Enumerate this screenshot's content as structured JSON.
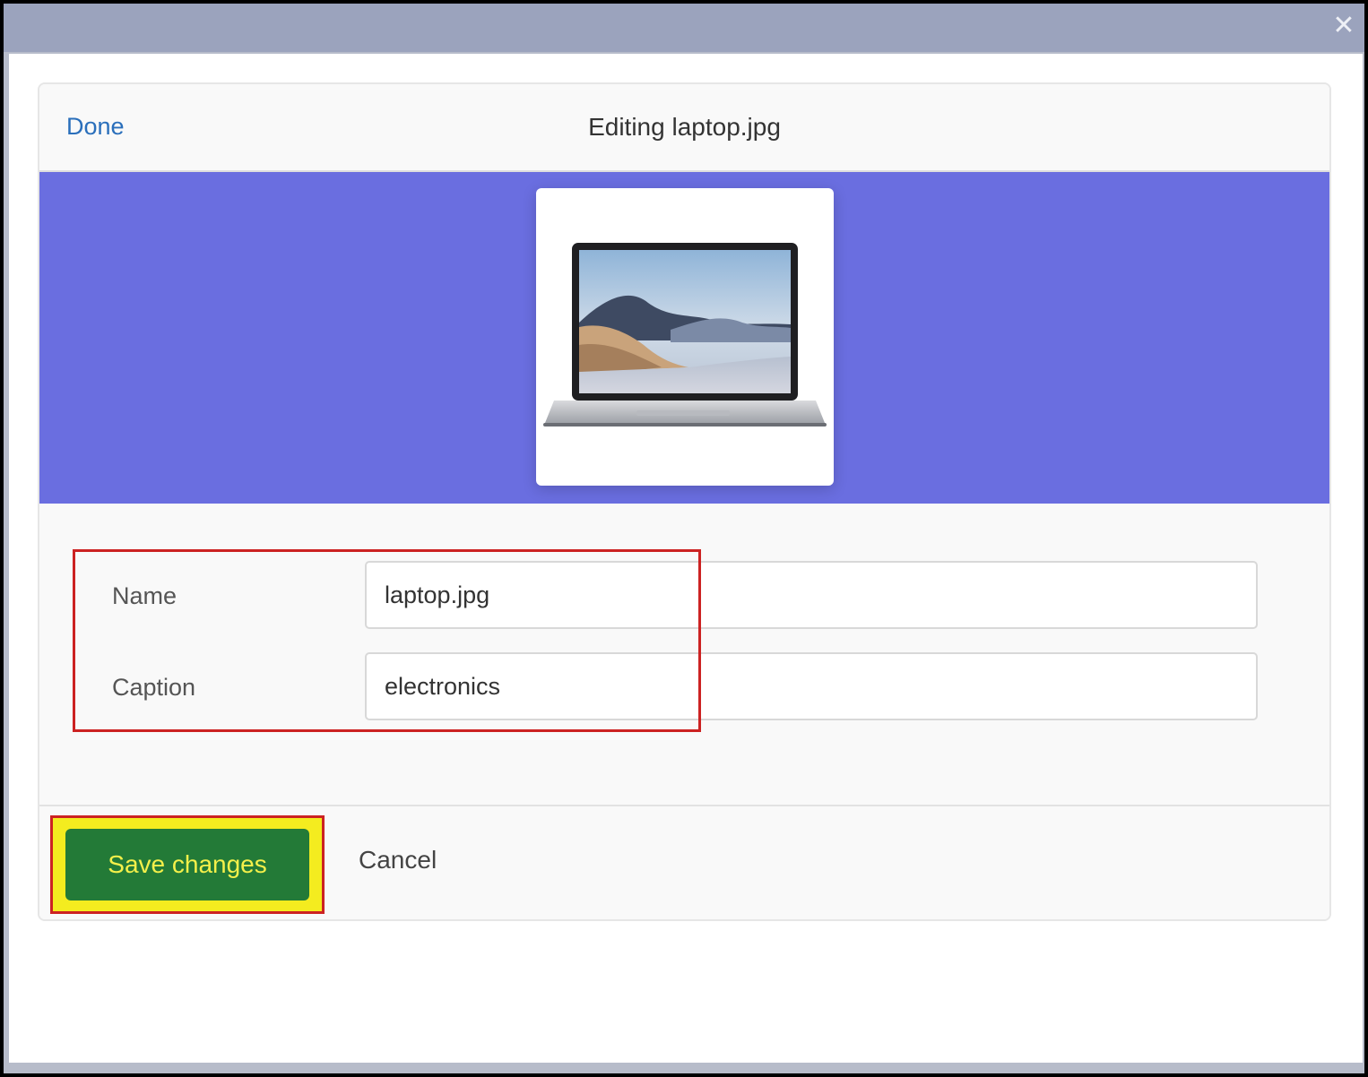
{
  "window": {
    "close_icon": "close-icon",
    "close_glyph": "✕"
  },
  "dialog": {
    "done_label": "Done",
    "title": "Editing laptop.jpg"
  },
  "preview": {
    "image_subject": "laptop",
    "band_color": "#6a6ee0"
  },
  "form": {
    "name_label": "Name",
    "name_value": "laptop.jpg",
    "caption_label": "Caption",
    "caption_value": "electronics"
  },
  "footer": {
    "save_label": "Save changes",
    "cancel_label": "Cancel"
  },
  "colors": {
    "accent_link": "#2a6fbb",
    "save_bg": "#237a37",
    "save_text": "#f4f04a",
    "annotation_red": "#cc2222",
    "annotation_yellow": "#f4ec1f"
  }
}
